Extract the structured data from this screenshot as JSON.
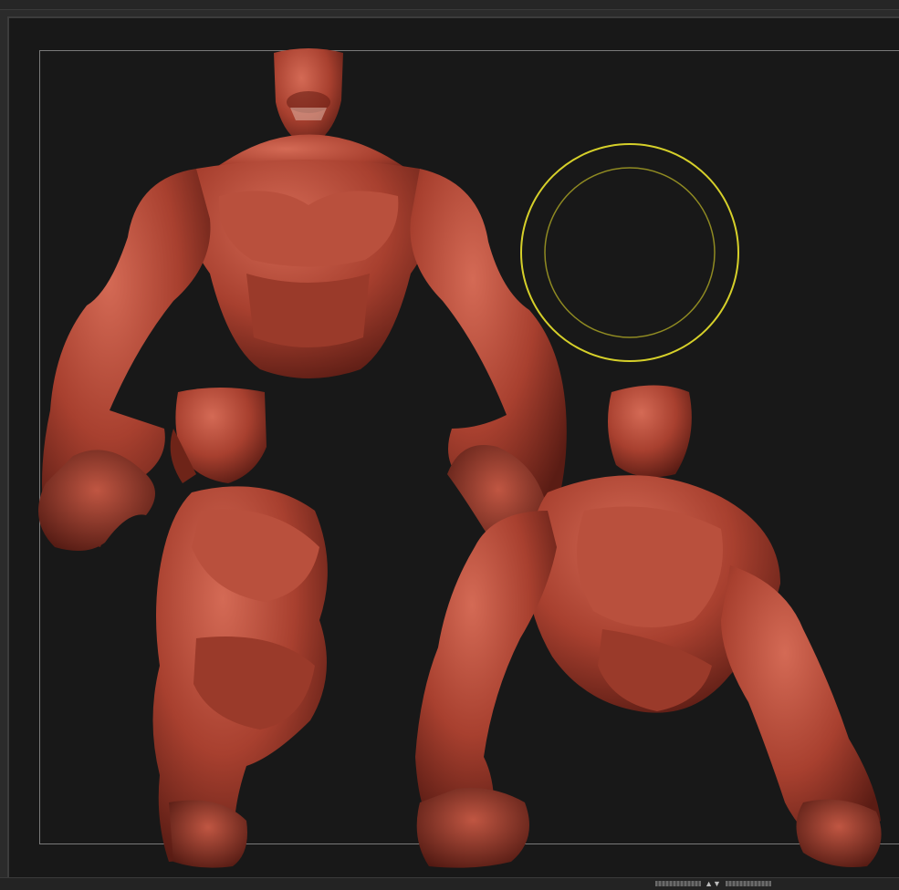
{
  "viewport": {
    "background": "#181818",
    "model_color": "#a8402f",
    "brush_cursor": {
      "outer_color": "#d6d02a",
      "inner_color": "#8f8a22"
    }
  },
  "scroll": {
    "arrows_glyph": "▲▼"
  }
}
